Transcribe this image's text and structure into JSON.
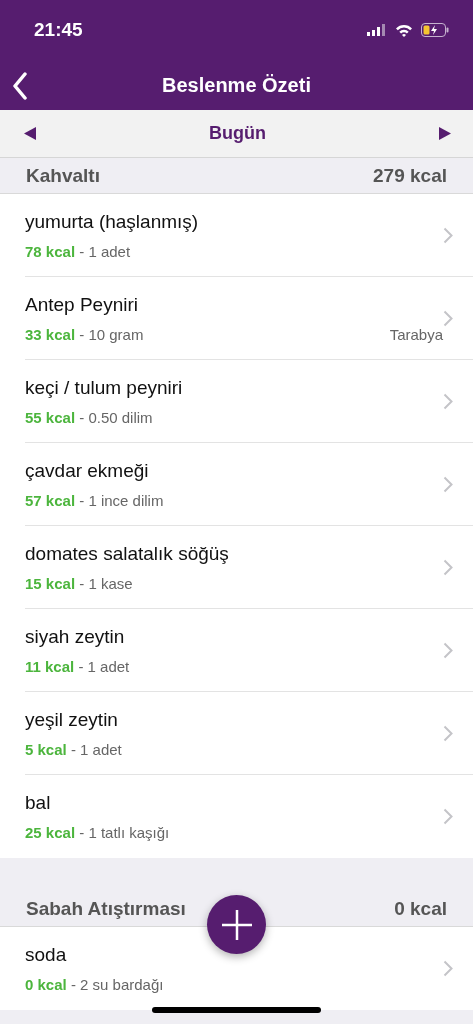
{
  "status_bar": {
    "time": "21:45"
  },
  "nav": {
    "title": "Beslenme Özeti"
  },
  "date_bar": {
    "label": "Bugün"
  },
  "meals": [
    {
      "name": "Kahvaltı",
      "total": "279 kcal",
      "items": [
        {
          "name": "yumurta (haşlanmış)",
          "kcal": "78 kcal",
          "portion": "- 1 adet"
        },
        {
          "name": "Antep Peyniri",
          "kcal": "33 kcal",
          "portion": "- 10 gram",
          "brand": "Tarabya"
        },
        {
          "name": "keçi / tulum peyniri",
          "kcal": "55 kcal",
          "portion": "- 0.50 dilim"
        },
        {
          "name": "çavdar ekmeği",
          "kcal": "57 kcal",
          "portion": "- 1 ince dilim"
        },
        {
          "name": "domates salatalık söğüş",
          "kcal": "15 kcal",
          "portion": "- 1 kase"
        },
        {
          "name": "siyah zeytin",
          "kcal": "11 kcal",
          "portion": "- 1 adet"
        },
        {
          "name": "yeşil zeytin",
          "kcal": "5 kcal",
          "portion": "- 1 adet"
        },
        {
          "name": "bal",
          "kcal": "25 kcal",
          "portion": "- 1 tatlı kaşığı"
        }
      ]
    },
    {
      "name": "Sabah Atıştırması",
      "total": "0 kcal",
      "items": [
        {
          "name": "soda",
          "kcal": "0 kcal",
          "portion": "- 2 su bardağı"
        }
      ]
    }
  ]
}
